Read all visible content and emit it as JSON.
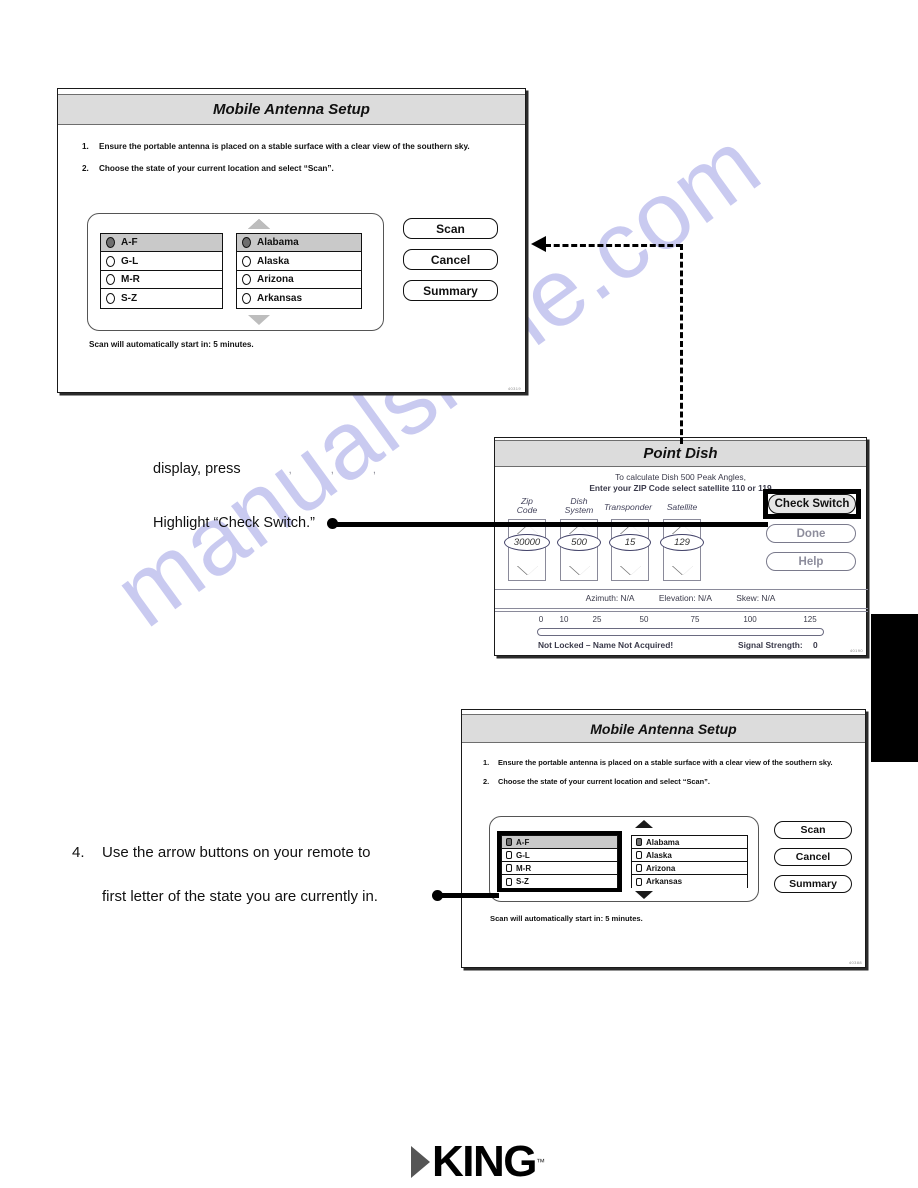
{
  "watermark": {
    "text": "manualshine.com"
  },
  "brand": {
    "name": "KING",
    "tm": "™"
  },
  "panel_top": {
    "title": "Mobile Antenna Setup",
    "steps": [
      {
        "num": "1.",
        "text": "Ensure the portable antenna is placed on a stable surface with a clear view of the southern sky."
      },
      {
        "num": "2.",
        "text": "Choose the state of your current location and select “Scan”."
      }
    ],
    "letter_groups": [
      {
        "label": "A-F",
        "selected": true
      },
      {
        "label": "G-L",
        "selected": false
      },
      {
        "label": "M-R",
        "selected": false
      },
      {
        "label": "S-Z",
        "selected": false
      }
    ],
    "states": [
      {
        "label": "Alabama",
        "selected": true
      },
      {
        "label": "Alaska",
        "selected": false
      },
      {
        "label": "Arizona",
        "selected": false
      },
      {
        "label": "Arkansas",
        "selected": false
      }
    ],
    "buttons": [
      "Scan",
      "Cancel",
      "Summary"
    ],
    "footer": "Scan will automatically start in: 5 minutes.",
    "idcode": "40319"
  },
  "panel_point_dish": {
    "title": "Point Dish",
    "subtitle_line1": "To calculate Dish 500 Peak Angles,",
    "subtitle_line2": "Enter your ZIP Code select satellite 110 or 119",
    "spinners": [
      {
        "label_line1": "Zip",
        "label_line2": "Code",
        "value": "30000"
      },
      {
        "label_line1": "Dish",
        "label_line2": "System",
        "value": "500"
      },
      {
        "label_line1": "Transponder",
        "label_line2": "",
        "value": "15"
      },
      {
        "label_line1": "Satellite",
        "label_line2": "",
        "value": "129"
      }
    ],
    "buttons": [
      {
        "label": "Check Switch",
        "state": "highlighted"
      },
      {
        "label": "Done",
        "state": "dim"
      },
      {
        "label": "Help",
        "state": "dim"
      }
    ],
    "angles": [
      {
        "name": "Azimuth:",
        "value": "N/A"
      },
      {
        "name": "Elevation:",
        "value": "N/A"
      },
      {
        "name": "Skew:",
        "value": "N/A"
      }
    ],
    "scale_ticks": [
      "0",
      "10",
      "25",
      "50",
      "75",
      "100",
      "125"
    ],
    "status_left": "Not Locked – Name Not Acquired!",
    "signal_label": "Signal Strength:",
    "signal_value": "0",
    "idcode": "40190"
  },
  "panel_bottom": {
    "title": "Mobile Antenna Setup",
    "steps": [
      {
        "num": "1.",
        "text": "Ensure the portable antenna is placed on a stable surface with a clear view of the southern sky."
      },
      {
        "num": "2.",
        "text": "Choose the state of your current location and select “Scan”."
      }
    ],
    "letter_groups": [
      {
        "label": "A-F",
        "selected": true
      },
      {
        "label": "G-L",
        "selected": false
      },
      {
        "label": "M-R",
        "selected": false
      },
      {
        "label": "S-Z",
        "selected": false
      }
    ],
    "states": [
      {
        "label": "Alabama",
        "selected": true
      },
      {
        "label": "Alaska",
        "selected": false
      },
      {
        "label": "Arizona",
        "selected": false
      },
      {
        "label": "Arkansas",
        "selected": false
      }
    ],
    "buttons": [
      "Scan",
      "Cancel",
      "Summary"
    ],
    "footer": "Scan will automatically start in: 5 minutes.",
    "idcode": "40388"
  },
  "annotations": {
    "display_press": "display, press",
    "display_press_marks": ",  ,  ,",
    "highlight_check_switch": "Highlight “Check Switch.”",
    "step4_num": "4.",
    "step4_line1": "Use the arrow buttons on your remote to",
    "step4_line2": "first letter of the state you are currently in."
  }
}
